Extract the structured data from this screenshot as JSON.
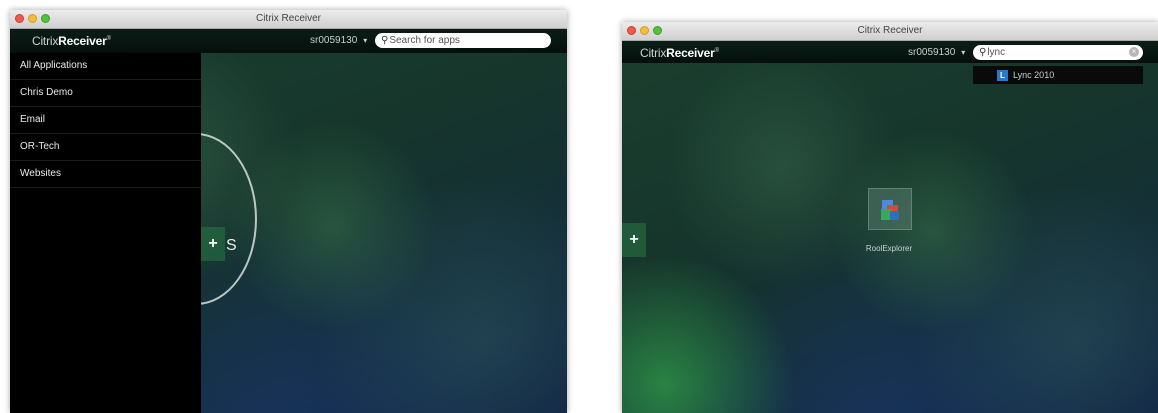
{
  "left_window": {
    "title": "Citrix Receiver",
    "brand_prefix": "Citrix",
    "brand_name": "Receiver",
    "brand_mark": "®",
    "user": "sr0059130",
    "search_placeholder": "Search for apps",
    "sidebar_items": [
      {
        "label": "All Applications"
      },
      {
        "label": "Chris Demo"
      },
      {
        "label": "Email"
      },
      {
        "label": "OR-Tech"
      },
      {
        "label": "Websites"
      }
    ],
    "add_label": "+",
    "ring_letter": "S"
  },
  "right_window": {
    "title": "Citrix Receiver",
    "brand_prefix": "Citrix",
    "brand_name": "Receiver",
    "brand_mark": "®",
    "user": "sr0059130",
    "search_value": "lync",
    "suggestion": "Lync 2010",
    "app_label": "RoolExplorer",
    "add_label": "+"
  },
  "colors": {
    "header": "#08160f",
    "sidebar": "#000000",
    "accent_green": "#3fa64e"
  },
  "icons": [
    "search-icon",
    "chevron-down-icon",
    "plus-icon",
    "clear-icon",
    "lync-icon",
    "app-icon"
  ]
}
